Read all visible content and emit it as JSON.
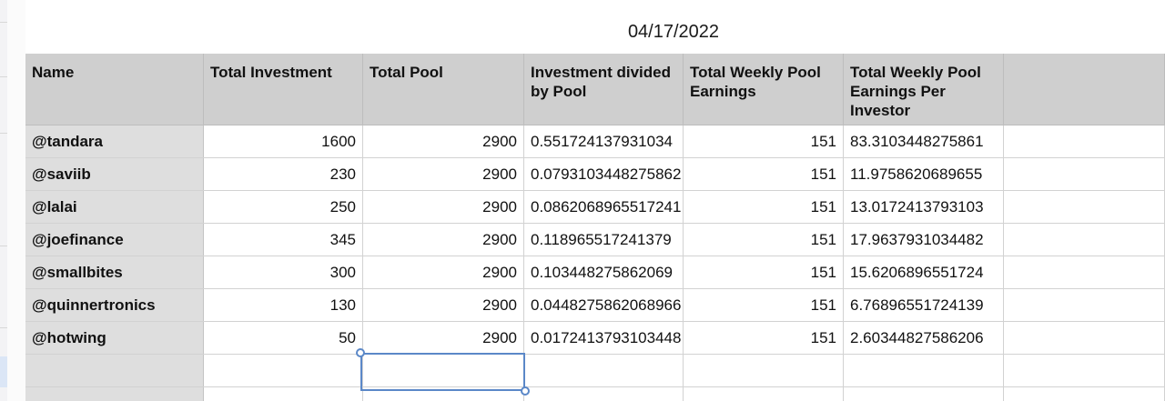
{
  "sheet": {
    "title": "04/17/2022"
  },
  "table": {
    "headers": [
      "Name",
      "Total Investment",
      "Total Pool",
      "Investment divided by Pool",
      "Total Weekly Pool Earnings",
      "Total Weekly Pool Earnings Per Investor",
      ""
    ],
    "rows": [
      {
        "name": "@tandara",
        "investment": "1600",
        "pool": "2900",
        "ratio": "0.551724137931034",
        "weekly": "151",
        "per_investor": "83.3103448275861"
      },
      {
        "name": "@saviib",
        "investment": "230",
        "pool": "2900",
        "ratio": "0.0793103448275862",
        "weekly": "151",
        "per_investor": "11.9758620689655"
      },
      {
        "name": "@lalai",
        "investment": "250",
        "pool": "2900",
        "ratio": "0.0862068965517241",
        "weekly": "151",
        "per_investor": "13.0172413793103"
      },
      {
        "name": "@joefinance",
        "investment": "345",
        "pool": "2900",
        "ratio": "0.118965517241379",
        "weekly": "151",
        "per_investor": "17.9637931034482"
      },
      {
        "name": "@smallbites",
        "investment": "300",
        "pool": "2900",
        "ratio": "0.103448275862069",
        "weekly": "151",
        "per_investor": "15.6206896551724"
      },
      {
        "name": "@quinnertronics",
        "investment": "130",
        "pool": "2900",
        "ratio": "0.0448275862068966",
        "weekly": "151",
        "per_investor": "6.76896551724139"
      },
      {
        "name": "@hotwing",
        "investment": "50",
        "pool": "2900",
        "ratio": "0.0172413793103448",
        "weekly": "151",
        "per_investor": "2.60344827586206"
      }
    ]
  }
}
